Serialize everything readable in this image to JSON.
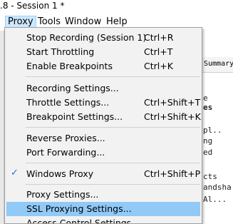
{
  "window": {
    "title": ".8 - Session 1 *"
  },
  "menubar": {
    "items": [
      {
        "label": "Proxy",
        "active": true
      },
      {
        "label": "Tools"
      },
      {
        "label": "Window"
      },
      {
        "label": "Help"
      }
    ]
  },
  "proxy_menu": {
    "groups": [
      [
        {
          "label": "Stop Recording (Session 1)",
          "shortcut": "Ctrl+R"
        },
        {
          "label": "Start Throttling",
          "shortcut": "Ctrl+T"
        },
        {
          "label": "Enable Breakpoints",
          "shortcut": "Ctrl+K"
        }
      ],
      [
        {
          "label": "Recording Settings...",
          "shortcut": ""
        },
        {
          "label": "Throttle Settings...",
          "shortcut": "Ctrl+Shift+T"
        },
        {
          "label": "Breakpoint Settings...",
          "shortcut": "Ctrl+Shift+K"
        }
      ],
      [
        {
          "label": "Reverse Proxies...",
          "shortcut": ""
        },
        {
          "label": "Port Forwarding...",
          "shortcut": ""
        }
      ],
      [
        {
          "label": "Windows Proxy",
          "shortcut": "Ctrl+Shift+P",
          "checked": true
        }
      ],
      [
        {
          "label": "Proxy Settings...",
          "shortcut": ""
        },
        {
          "label": "SSL Proxying Settings...",
          "shortcut": "",
          "highlighted": true
        },
        {
          "label": "Access Control Settings...",
          "shortcut": ""
        }
      ]
    ],
    "check_glyph": "✓"
  },
  "background": {
    "header": "Summary",
    "lines": [
      {
        "text": "e",
        "bold": false
      },
      {
        "text": "es",
        "bold": true
      },
      {
        "text": "pl..",
        "bold": false
      },
      {
        "text": "ng",
        "bold": false
      },
      {
        "text": "ed",
        "bold": false
      },
      {
        "text": "cts",
        "bold": false
      },
      {
        "text": "andsha..",
        "bold": false
      },
      {
        "text": "Al...",
        "bold": false
      }
    ]
  },
  "colors": {
    "highlight": "#91c9f7",
    "menu_active": "#cce8ff",
    "check": "#1e6fd9"
  }
}
